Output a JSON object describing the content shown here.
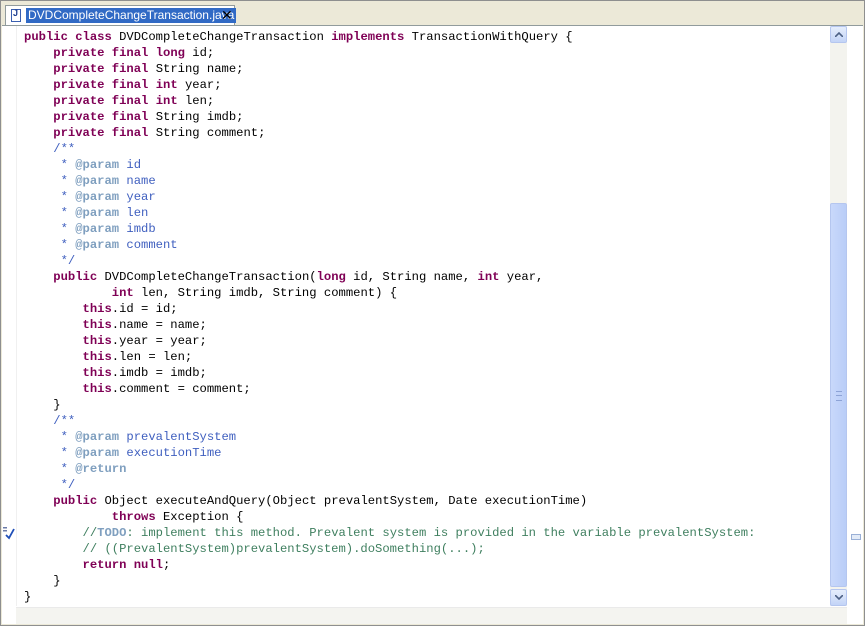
{
  "tab": {
    "title": "DVDCompleteChangeTransaction.java",
    "close_glyph": "✕",
    "icon": "java-file-icon"
  },
  "gutter": {
    "task_marker_icon": "task-checkmark-icon"
  },
  "scrollbars": {
    "vertical_thumb_position": 0.34
  },
  "code_lines": [
    [
      [
        "kw",
        "public"
      ],
      [
        "",
        " "
      ],
      [
        "kw",
        "class"
      ],
      [
        "",
        " DVDCompleteChangeTransaction "
      ],
      [
        "kw",
        "implements"
      ],
      [
        "",
        " TransactionWithQuery {"
      ]
    ],
    [
      [
        "",
        "    "
      ],
      [
        "kw",
        "private"
      ],
      [
        "",
        " "
      ],
      [
        "kw",
        "final"
      ],
      [
        "",
        " "
      ],
      [
        "kw",
        "long"
      ],
      [
        "",
        " id;"
      ]
    ],
    [
      [
        "",
        "    "
      ],
      [
        "kw",
        "private"
      ],
      [
        "",
        " "
      ],
      [
        "kw",
        "final"
      ],
      [
        "",
        " String name;"
      ]
    ],
    [
      [
        "",
        "    "
      ],
      [
        "kw",
        "private"
      ],
      [
        "",
        " "
      ],
      [
        "kw",
        "final"
      ],
      [
        "",
        " "
      ],
      [
        "kw",
        "int"
      ],
      [
        "",
        " year;"
      ]
    ],
    [
      [
        "",
        "    "
      ],
      [
        "kw",
        "private"
      ],
      [
        "",
        " "
      ],
      [
        "kw",
        "final"
      ],
      [
        "",
        " "
      ],
      [
        "kw",
        "int"
      ],
      [
        "",
        " len;"
      ]
    ],
    [
      [
        "",
        "    "
      ],
      [
        "kw",
        "private"
      ],
      [
        "",
        " "
      ],
      [
        "kw",
        "final"
      ],
      [
        "",
        " String imdb;"
      ]
    ],
    [
      [
        "",
        "    "
      ],
      [
        "kw",
        "private"
      ],
      [
        "",
        " "
      ],
      [
        "kw",
        "final"
      ],
      [
        "",
        " String comment;"
      ]
    ],
    [
      [
        "doc",
        "    /**"
      ]
    ],
    [
      [
        "doc",
        "     * "
      ],
      [
        "tag",
        "@param"
      ],
      [
        "doc",
        " id"
      ]
    ],
    [
      [
        "doc",
        "     * "
      ],
      [
        "tag",
        "@param"
      ],
      [
        "doc",
        " name"
      ]
    ],
    [
      [
        "doc",
        "     * "
      ],
      [
        "tag",
        "@param"
      ],
      [
        "doc",
        " year"
      ]
    ],
    [
      [
        "doc",
        "     * "
      ],
      [
        "tag",
        "@param"
      ],
      [
        "doc",
        " len"
      ]
    ],
    [
      [
        "doc",
        "     * "
      ],
      [
        "tag",
        "@param"
      ],
      [
        "doc",
        " imdb"
      ]
    ],
    [
      [
        "doc",
        "     * "
      ],
      [
        "tag",
        "@param"
      ],
      [
        "doc",
        " comment"
      ]
    ],
    [
      [
        "doc",
        "     */"
      ]
    ],
    [
      [
        "",
        "    "
      ],
      [
        "kw",
        "public"
      ],
      [
        "",
        " DVDCompleteChangeTransaction("
      ],
      [
        "kw",
        "long"
      ],
      [
        "",
        " id, String name, "
      ],
      [
        "kw",
        "int"
      ],
      [
        "",
        " year,"
      ]
    ],
    [
      [
        "",
        "            "
      ],
      [
        "kw",
        "int"
      ],
      [
        "",
        " len, String imdb, String comment) {"
      ]
    ],
    [
      [
        "",
        "        "
      ],
      [
        "kw",
        "this"
      ],
      [
        "",
        ".id = id;"
      ]
    ],
    [
      [
        "",
        "        "
      ],
      [
        "kw",
        "this"
      ],
      [
        "",
        ".name = name;"
      ]
    ],
    [
      [
        "",
        "        "
      ],
      [
        "kw",
        "this"
      ],
      [
        "",
        ".year = year;"
      ]
    ],
    [
      [
        "",
        "        "
      ],
      [
        "kw",
        "this"
      ],
      [
        "",
        ".len = len;"
      ]
    ],
    [
      [
        "",
        "        "
      ],
      [
        "kw",
        "this"
      ],
      [
        "",
        ".imdb = imdb;"
      ]
    ],
    [
      [
        "",
        "        "
      ],
      [
        "kw",
        "this"
      ],
      [
        "",
        ".comment = comment;"
      ]
    ],
    [
      [
        "",
        "    }"
      ]
    ],
    [
      [
        "doc",
        "    /**"
      ]
    ],
    [
      [
        "doc",
        "     * "
      ],
      [
        "tag",
        "@param"
      ],
      [
        "doc",
        " prevalentSystem"
      ]
    ],
    [
      [
        "doc",
        "     * "
      ],
      [
        "tag",
        "@param"
      ],
      [
        "doc",
        " executionTime"
      ]
    ],
    [
      [
        "doc",
        "     * "
      ],
      [
        "tag",
        "@return"
      ]
    ],
    [
      [
        "doc",
        "     */"
      ]
    ],
    [
      [
        "",
        "    "
      ],
      [
        "kw",
        "public"
      ],
      [
        "",
        " Object executeAndQuery(Object prevalentSystem, Date executionTime)"
      ]
    ],
    [
      [
        "",
        "            "
      ],
      [
        "kw",
        "throws"
      ],
      [
        "",
        " Exception {"
      ]
    ],
    [
      [
        "cmt",
        "        //"
      ],
      [
        "tag",
        "TODO"
      ],
      [
        "cmt",
        ": implement this method. Prevalent system is provided in the variable prevalentSystem:"
      ]
    ],
    [
      [
        "cmt",
        "        // ((PrevalentSystem)prevalentSystem).doSomething(...);"
      ]
    ],
    [
      [
        "",
        "        "
      ],
      [
        "kw",
        "return"
      ],
      [
        "",
        " "
      ],
      [
        "kw",
        "null"
      ],
      [
        "",
        ";"
      ]
    ],
    [
      [
        "",
        "    }"
      ]
    ],
    [
      [
        "",
        "}"
      ]
    ]
  ],
  "colors": {
    "keyword": "#7f0055",
    "javadoc": "#3f5fbf",
    "javadoc_tag": "#7f9fbf",
    "comment": "#3f7f5f",
    "tab_selected": "#316ac5"
  }
}
